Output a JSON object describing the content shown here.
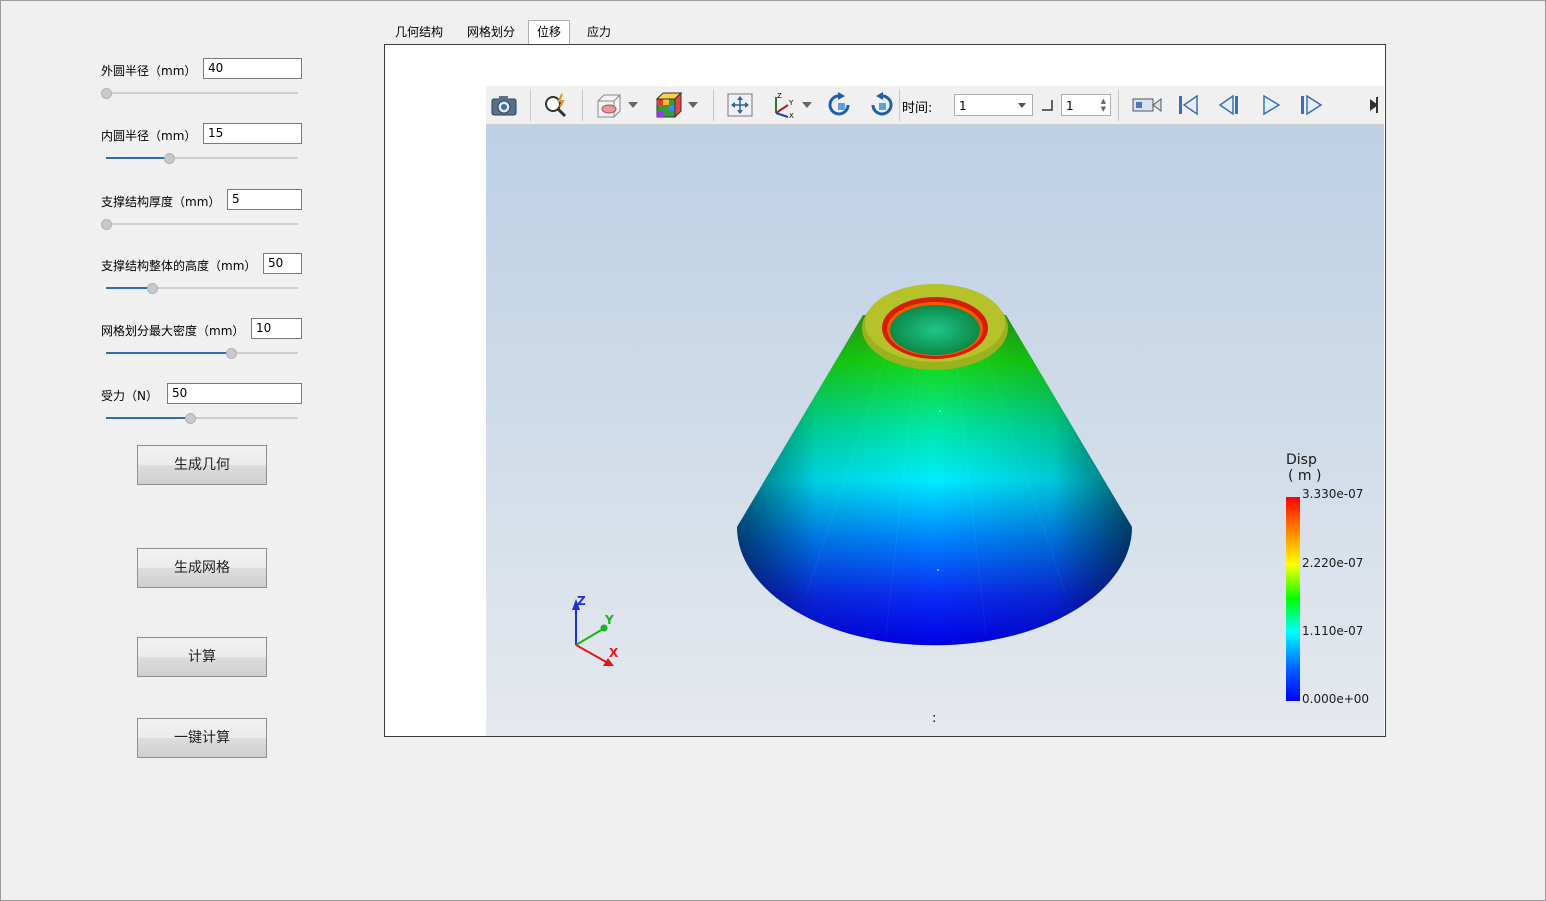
{
  "params": [
    {
      "label": "外圆半径（mm）",
      "value": "40",
      "slider": 0.0
    },
    {
      "label": "内圆半径（mm）",
      "value": "15",
      "slider": 0.33
    },
    {
      "label": "支撑结构厚度（mm）",
      "value": "5",
      "slider": 0.0
    },
    {
      "label": "支撑结构整体的高度（mm）",
      "value": "50",
      "slider": 0.24
    },
    {
      "label": "网格划分最大密度（mm）",
      "value": "10",
      "slider": 0.65
    },
    {
      "label": "受力（N）",
      "value": "50",
      "slider": 0.44
    }
  ],
  "buttons": {
    "generate_geometry": "生成几何",
    "generate_mesh": "生成网格",
    "compute": "计算",
    "one_click_compute": "一键计算"
  },
  "tabs": [
    "几何结构",
    "网格划分",
    "位移",
    "应力"
  ],
  "active_tab": "位移",
  "toolbar": {
    "time_label": "时间:",
    "time_value": "1",
    "step_value": "1",
    "icons": [
      "camera-icon",
      "zoom-icon",
      "slice-icon",
      "color-cube-icon",
      "reset-view-icon",
      "axes-icon",
      "rotate-cw-icon",
      "rotate-ccw-icon",
      "record-icon",
      "first-frame-icon",
      "prev-frame-icon",
      "play-icon",
      "last-frame-icon"
    ]
  },
  "legend": {
    "title": "Disp",
    "unit": "( m )",
    "ticks": [
      "3.330e-07",
      "2.220e-07",
      "1.110e-07",
      "0.000e+00"
    ],
    "colors": [
      "#ff0000",
      "#ffff00",
      "#00ff00",
      "#00ffff",
      "#0000ff"
    ]
  },
  "axes": {
    "x": "X",
    "y": "Y",
    "z": "Z"
  },
  "footer_mark": ":"
}
